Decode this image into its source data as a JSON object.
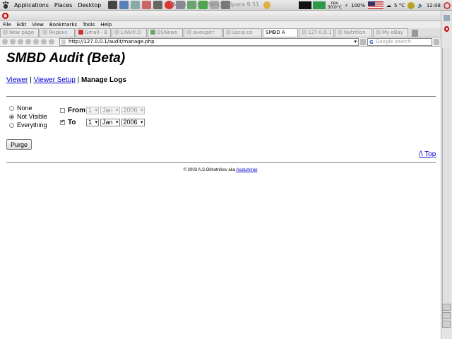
{
  "panel": {
    "menus": [
      "Applications",
      "Places",
      "Desktop"
    ],
    "window_title": "SMBD Audit (Beta) - Opera 9.51",
    "cpu_label": "cpu",
    "cpu_temp": "30.0°C",
    "battery": "100%",
    "temperature": "5 °C",
    "clock": "12:08"
  },
  "menubar": [
    "File",
    "Edit",
    "View",
    "Bookmarks",
    "Tools",
    "Help"
  ],
  "tabs": [
    {
      "label": "New page",
      "active": false
    },
    {
      "label": "Яндекс",
      "active": false
    },
    {
      "label": "Gmail - B",
      "active": false
    },
    {
      "label": "LINUX.O",
      "active": false
    },
    {
      "label": "OSNews",
      "active": false
    },
    {
      "label": "анекдот",
      "active": false
    },
    {
      "label": "Local.co",
      "active": false
    },
    {
      "label": "SMBD A",
      "active": true
    },
    {
      "label": "127.0.0.1",
      "active": false
    },
    {
      "label": "Nutrition",
      "active": false
    },
    {
      "label": "My eBay",
      "active": false
    }
  ],
  "address": {
    "url": "http://127.0.0.1/audit/manage.php"
  },
  "search": {
    "placeholder": "Google search"
  },
  "page": {
    "title": "SMBD Audit (Beta)",
    "nav": {
      "viewer": "Viewer",
      "sep": "|",
      "viewer_setup": "Viewer Setup",
      "manage_logs": "Manage Logs"
    },
    "visibility": [
      {
        "label": "None",
        "checked": false
      },
      {
        "label": "Not Visible",
        "checked": true
      },
      {
        "label": "Everything",
        "checked": false
      }
    ],
    "from": {
      "label": "From",
      "checked": false,
      "day": "1",
      "month": "Jan",
      "year": "2006"
    },
    "to": {
      "label": "To",
      "checked": true,
      "day": "1",
      "month": "Jan",
      "year": "2006"
    },
    "purge_label": "Purge",
    "top_link": "/\\ Top",
    "footer_text": "© 2003 A.S.Okhotnikov aka",
    "footer_link": "Acidumirae"
  }
}
